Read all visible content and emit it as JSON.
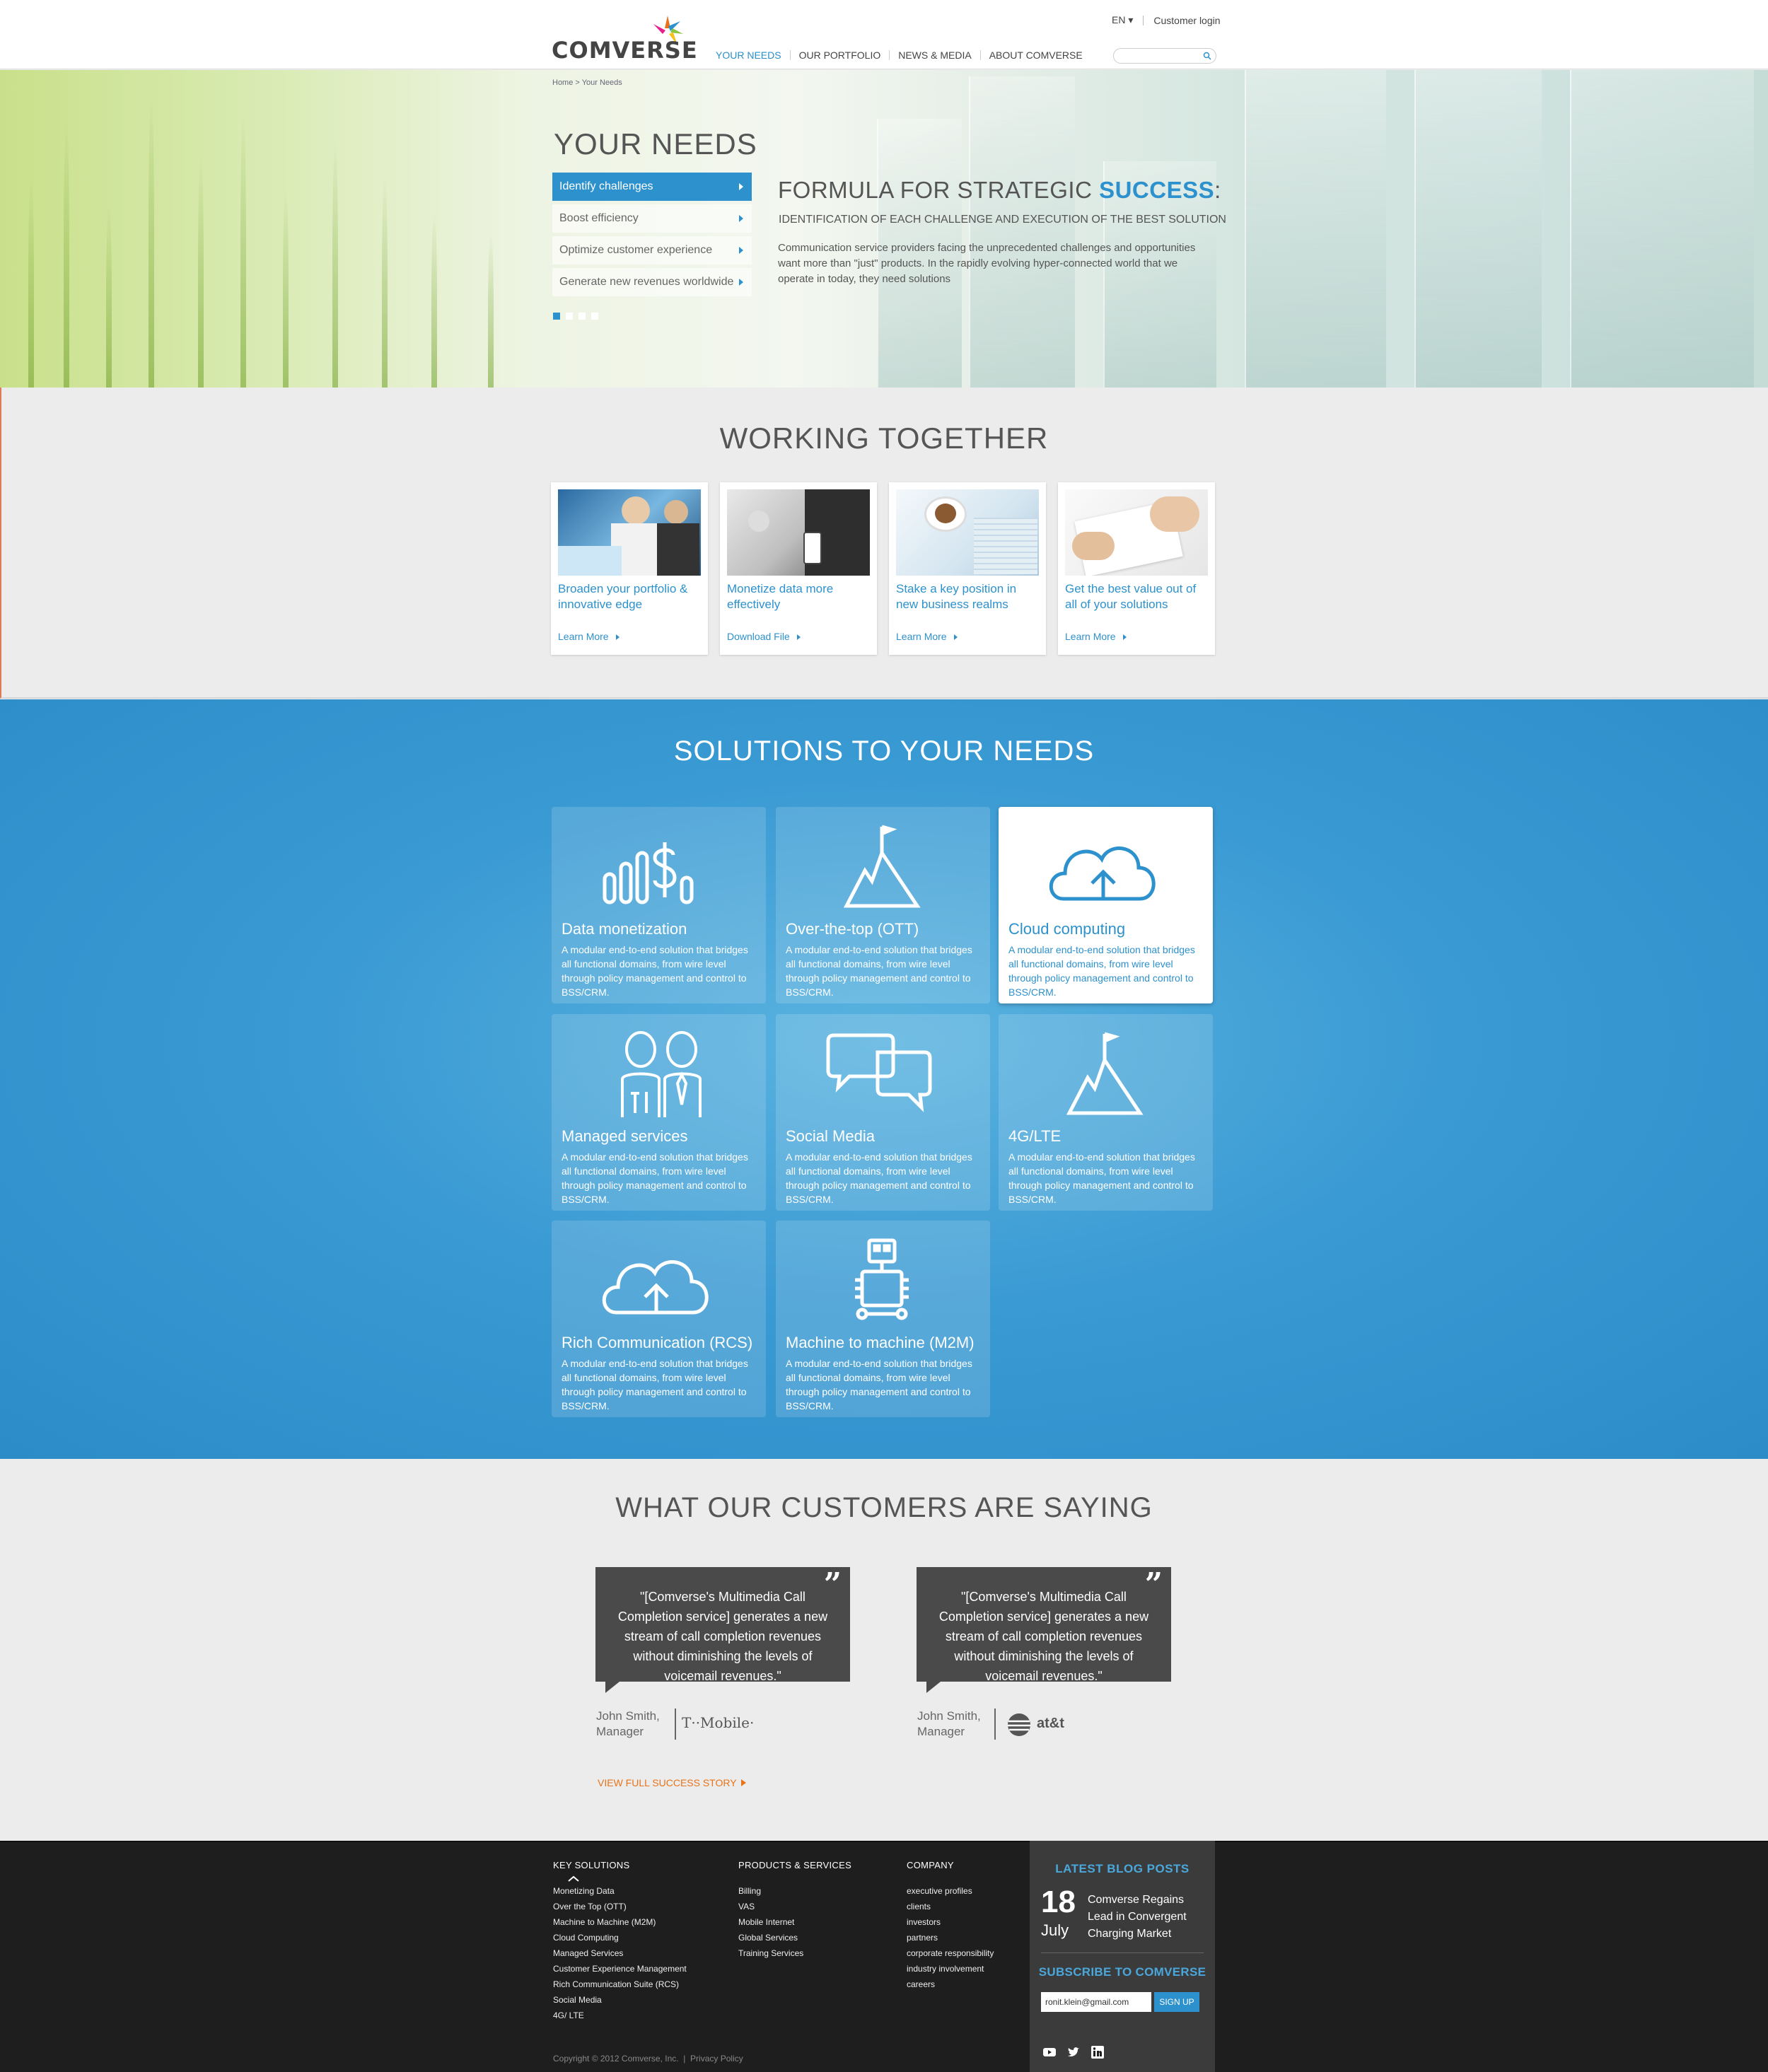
{
  "header": {
    "logo": "COMVERSE",
    "language": "EN",
    "customer_login": "Customer login",
    "nav": [
      "YOUR NEEDS",
      "OUR PORTFOLIO",
      "NEWS & MEDIA",
      "ABOUT COMVERSE"
    ],
    "search_placeholder": ""
  },
  "hero": {
    "breadcrumb": [
      "Home",
      ">",
      "Your Needs"
    ],
    "title": "YOUR NEEDS",
    "menu": [
      "Identify challenges",
      "Boost efficiency",
      "Optimize customer experience",
      "Generate new revenues worldwide"
    ],
    "active_slide": 1,
    "slide_count": 4,
    "headline_prefix": "FORMULA FOR STRATEGIC ",
    "headline_highlight": "SUCCESS",
    "headline_suffix": ":",
    "subheadline": "IDENTIFICATION OF EACH CHALLENGE AND EXECUTION OF THE BEST SOLUTION",
    "body": "Communication service providers facing the unprecedented challenges and opportunities want more than \"just\" products. In the rapidly evolving hyper-connected world that we operate in today, they need solutions"
  },
  "working_together": {
    "title": "WORKING TOGETHER",
    "cards": [
      {
        "text": "Broaden your portfolio & innovative edge",
        "link": "Learn More"
      },
      {
        "text": "Monetize data more effectively",
        "link": "Download File"
      },
      {
        "text": "Stake a key position in new business realms",
        "link": "Learn More"
      },
      {
        "text": "Get the best value out of all of your solutions",
        "link": "Learn More"
      }
    ]
  },
  "solutions": {
    "title": "SOLUTIONS TO YOUR NEEDS",
    "description": "A modular end-to-end solution that bridges all functional domains, from wire level through policy management and control to BSS/CRM.",
    "tiles": [
      {
        "title": "Data monetization",
        "icon": "dollar-bars-icon"
      },
      {
        "title": "Over-the-top (OTT)",
        "icon": "mountain-flag-icon"
      },
      {
        "title": "Cloud computing",
        "icon": "cloud-upload-icon"
      },
      {
        "title": "Managed services",
        "icon": "people-tools-icon"
      },
      {
        "title": "Social Media",
        "icon": "chat-bubbles-icon"
      },
      {
        "title": "4G/LTE",
        "icon": "mountain-flag-icon"
      },
      {
        "title": "Rich Communication (RCS)",
        "icon": "cloud-upload-icon"
      },
      {
        "title": "Machine to machine (M2M)",
        "icon": "robot-icon"
      }
    ]
  },
  "customers": {
    "title": "WHAT OUR CUSTOMERS ARE SAYING",
    "quotes": [
      {
        "text": "\"[Comverse's Multimedia Call Completion service] generates a new stream of call completion revenues without diminishing the levels of voicemail revenues.\"",
        "author_name": "John Smith,",
        "author_role": "Manager",
        "brand": "T··Mobile·"
      },
      {
        "text": "\"[Comverse's Multimedia Call Completion service] generates a new stream of call completion revenues without diminishing the levels of voicemail revenues.\"",
        "author_name": "John Smith,",
        "author_role": "Manager",
        "brand": "at&t"
      }
    ],
    "view_story": "VIEW FULL SUCCESS STORY"
  },
  "footer": {
    "key_solutions": {
      "heading": "KEY SOLUTIONS",
      "items": [
        "Monetizing Data",
        "Over the Top (OTT)",
        "Machine to Machine (M2M)",
        "Cloud Computing",
        "Managed Services",
        "Customer Experience Management",
        "Rich Communication Suite (RCS)",
        "Social Media",
        "4G/ LTE"
      ]
    },
    "products": {
      "heading": "PRODUCTS & SERVICES",
      "items": [
        "Billing",
        "VAS",
        "Mobile Internet",
        "Global Services",
        "Training Services"
      ]
    },
    "company": {
      "heading": "COMPANY",
      "items": [
        "executive profiles",
        "clients",
        "investors",
        "partners",
        "corporate responsibility",
        "industry involvement",
        "careers"
      ]
    },
    "blog": {
      "heading": "LATEST BLOG POSTS",
      "day": "18",
      "month": "July",
      "post": "Comverse Regains Lead in Convergent Charging Market"
    },
    "subscribe": {
      "heading": "SUBSCRIBE TO COMVERSE",
      "email": "ronit.klein@gmail.com",
      "button": "SIGN UP"
    },
    "copyright": "Copyright © 2012 Comverse, Inc.",
    "privacy": "Privacy Policy"
  },
  "colors": {
    "accent": "#2c91cd",
    "orange": "#e8731b",
    "footer_bg": "#1e1e1e"
  }
}
